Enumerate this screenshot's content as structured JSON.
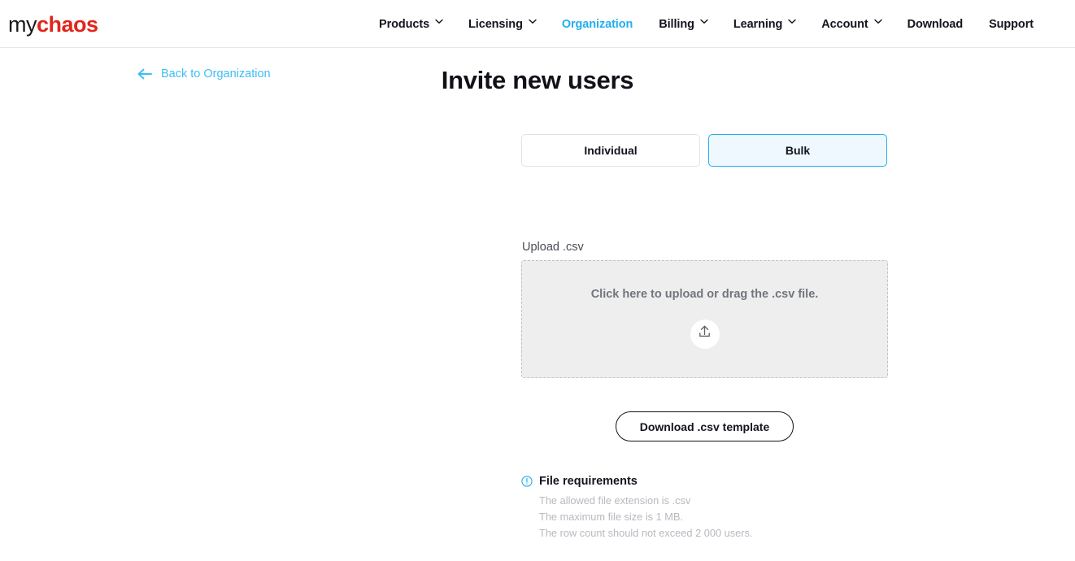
{
  "brand": {
    "logo_primary": "my",
    "logo_secondary": "chaos",
    "logo_secondary_color": "#e1251b"
  },
  "header": {
    "nav": [
      {
        "label": "Products",
        "has_dropdown": true,
        "active": false
      },
      {
        "label": "Licensing",
        "has_dropdown": true,
        "active": false
      },
      {
        "label": "Organization",
        "has_dropdown": false,
        "active": true
      },
      {
        "label": "Billing",
        "has_dropdown": true,
        "active": false
      },
      {
        "label": "Learning",
        "has_dropdown": true,
        "active": false
      },
      {
        "label": "Account",
        "has_dropdown": true,
        "active": false
      },
      {
        "label": "Download",
        "has_dropdown": false,
        "active": false
      },
      {
        "label": "Support",
        "has_dropdown": false,
        "active": false
      }
    ],
    "accent_color": "#22aeef"
  },
  "back_link": {
    "label": "Back to Organization",
    "icon": "arrow-left-icon",
    "color": "#3fbdf4"
  },
  "page": {
    "title": "Invite new users"
  },
  "mode_toggle": {
    "options": [
      {
        "label": "Individual",
        "selected": false
      },
      {
        "label": "Bulk",
        "selected": true
      }
    ]
  },
  "upload": {
    "label": "Upload .csv",
    "dropzone_text": "Click here to upload or drag the .csv file.",
    "icon": "upload-icon"
  },
  "actions": {
    "download_template_label": "Download .csv template"
  },
  "file_requirements": {
    "icon": "info-icon",
    "title": "File requirements",
    "items": [
      "The allowed file extension is .csv",
      "The maximum file size is 1 MB.",
      "The row count should not exceed 2 000 users."
    ]
  }
}
